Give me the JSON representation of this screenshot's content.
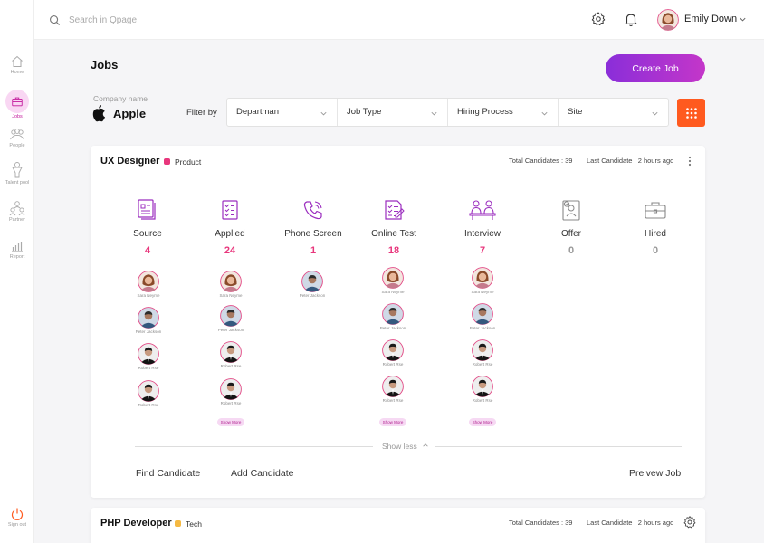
{
  "search": {
    "placeholder": "Search in Qpage"
  },
  "user": {
    "name": "Emily Down"
  },
  "sidebar": {
    "items": [
      {
        "label": "Home"
      },
      {
        "label": "Jobs"
      },
      {
        "label": "People"
      },
      {
        "label": "Talent pool"
      },
      {
        "label": "Partner"
      },
      {
        "label": "Report"
      }
    ],
    "signout": "Sign out"
  },
  "page": {
    "title": "Jobs",
    "create_label": "Create Job"
  },
  "company": {
    "caption": "Company name",
    "name": "Apple"
  },
  "filters": {
    "label": "Filter by",
    "selects": [
      "Departman",
      "Job Type",
      "Hiring Process",
      "Site"
    ]
  },
  "job1": {
    "title": "UX Designer",
    "tag": "Product",
    "total": "Total Candidates : 39",
    "last": "Last Candidate : 2 hours ago",
    "stages": [
      {
        "label": "Source",
        "count": "4"
      },
      {
        "label": "Applied",
        "count": "24"
      },
      {
        "label": "Phone Screen",
        "count": "1"
      },
      {
        "label": "Online Test",
        "count": "18"
      },
      {
        "label": "Interview",
        "count": "7"
      },
      {
        "label": "Offer",
        "count": "0"
      },
      {
        "label": "Hired",
        "count": "0"
      }
    ],
    "candidate_names": [
      "Sara Neyme",
      "Peter Jackson",
      "Robert Rse",
      "Robert Rse"
    ],
    "show_more": "Show More",
    "show_less": "Show less",
    "find": "Find Candidate",
    "add": "Add Candidate",
    "preview": "Preivew Job"
  },
  "job2": {
    "title": "PHP Developer",
    "tag": "Tech",
    "total": "Total Candidates : 39",
    "last": "Last Candidate : 2 hours ago"
  },
  "colors": {
    "accent": "#c3199c",
    "pink_count": "#e8367c",
    "orange": "#ff5a1f",
    "product_tag": "#e8367c",
    "tech_tag": "#f5b942"
  }
}
